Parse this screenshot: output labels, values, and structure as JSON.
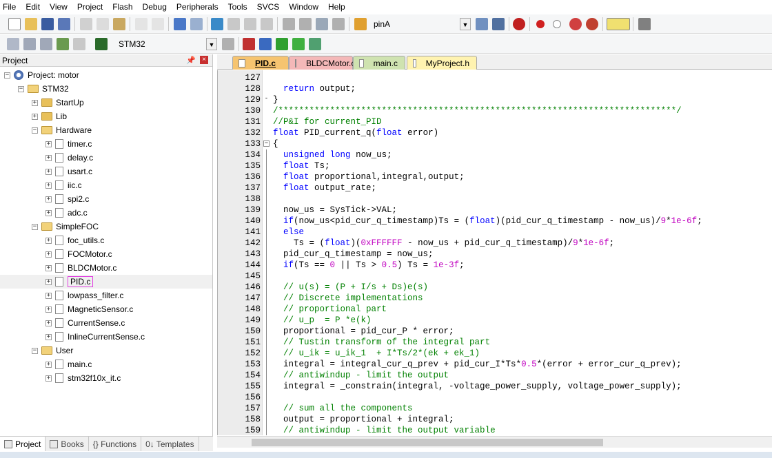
{
  "menu": [
    "File",
    "Edit",
    "View",
    "Project",
    "Flash",
    "Debug",
    "Peripherals",
    "Tools",
    "SVCS",
    "Window",
    "Help"
  ],
  "toolbar1": {
    "find_value": "pinA"
  },
  "toolbar2": {
    "target_value": "STM32"
  },
  "project_panel": {
    "title": "Project",
    "tabs": [
      "Project",
      "Books",
      "{} Functions",
      "0↓ Templates"
    ]
  },
  "tree": {
    "root": "Project: motor",
    "target": "STM32",
    "groups": {
      "startup": "StartUp",
      "lib": "Lib",
      "hardware": "Hardware",
      "simplefoc": "SimpleFOC",
      "user": "User"
    },
    "hardware_files": [
      "timer.c",
      "delay.c",
      "usart.c",
      "iic.c",
      "spi2.c",
      "adc.c"
    ],
    "simplefoc_files": [
      "foc_utils.c",
      "FOCMotor.c",
      "BLDCMotor.c",
      "PID.c",
      "lowpass_filter.c",
      "MagneticSensor.c",
      "CurrentSense.c",
      "InlineCurrentSense.c"
    ],
    "user_files": [
      "main.c",
      "stm32f10x_it.c"
    ]
  },
  "editor_tabs": [
    "PID.c",
    "BLDCMotor.c",
    "main.c",
    "MyProject.h"
  ],
  "code": [
    {
      "n": "127",
      "t": ""
    },
    {
      "n": "128",
      "t": "  return output;"
    },
    {
      "n": "129",
      "t": "}"
    },
    {
      "n": "130",
      "t": "/*****************************************************************************/"
    },
    {
      "n": "131",
      "t": "//P&I for current_PID"
    },
    {
      "n": "132",
      "t": "float PID_current_q(float error)"
    },
    {
      "n": "133",
      "t": "{"
    },
    {
      "n": "134",
      "t": "  unsigned long now_us;"
    },
    {
      "n": "135",
      "t": "  float Ts;"
    },
    {
      "n": "136",
      "t": "  float proportional,integral,output;"
    },
    {
      "n": "137",
      "t": "  float output_rate;"
    },
    {
      "n": "138",
      "t": ""
    },
    {
      "n": "139",
      "t": "  now_us = SysTick->VAL;"
    },
    {
      "n": "140",
      "t": "  if(now_us<pid_cur_q_timestamp)Ts = (float)(pid_cur_q_timestamp - now_us)/9*1e-6f;"
    },
    {
      "n": "141",
      "t": "  else"
    },
    {
      "n": "142",
      "t": "    Ts = (float)(0xFFFFFF - now_us + pid_cur_q_timestamp)/9*1e-6f;"
    },
    {
      "n": "143",
      "t": "  pid_cur_q_timestamp = now_us;"
    },
    {
      "n": "144",
      "t": "  if(Ts == 0 || Ts > 0.5) Ts = 1e-3f;"
    },
    {
      "n": "145",
      "t": ""
    },
    {
      "n": "146",
      "t": "  // u(s) = (P + I/s + Ds)e(s)"
    },
    {
      "n": "147",
      "t": "  // Discrete implementations"
    },
    {
      "n": "148",
      "t": "  // proportional part"
    },
    {
      "n": "149",
      "t": "  // u_p  = P *e(k)"
    },
    {
      "n": "150",
      "t": "  proportional = pid_cur_P * error;"
    },
    {
      "n": "151",
      "t": "  // Tustin transform of the integral part"
    },
    {
      "n": "152",
      "t": "  // u_ik = u_ik_1  + I*Ts/2*(ek + ek_1)"
    },
    {
      "n": "153",
      "t": "  integral = integral_cur_q_prev + pid_cur_I*Ts*0.5*(error + error_cur_q_prev);"
    },
    {
      "n": "154",
      "t": "  // antiwindup - limit the output"
    },
    {
      "n": "155",
      "t": "  integral = _constrain(integral, -voltage_power_supply, voltage_power_supply);"
    },
    {
      "n": "156",
      "t": ""
    },
    {
      "n": "157",
      "t": "  // sum all the components"
    },
    {
      "n": "158",
      "t": "  output = proportional + integral;"
    },
    {
      "n": "159",
      "t": "  // antiwindup - limit the output variable"
    }
  ],
  "colors": {
    "keyword": "#0000ff",
    "comment": "#008000",
    "number": "#c000c0",
    "active_tab": "#f6c470"
  }
}
